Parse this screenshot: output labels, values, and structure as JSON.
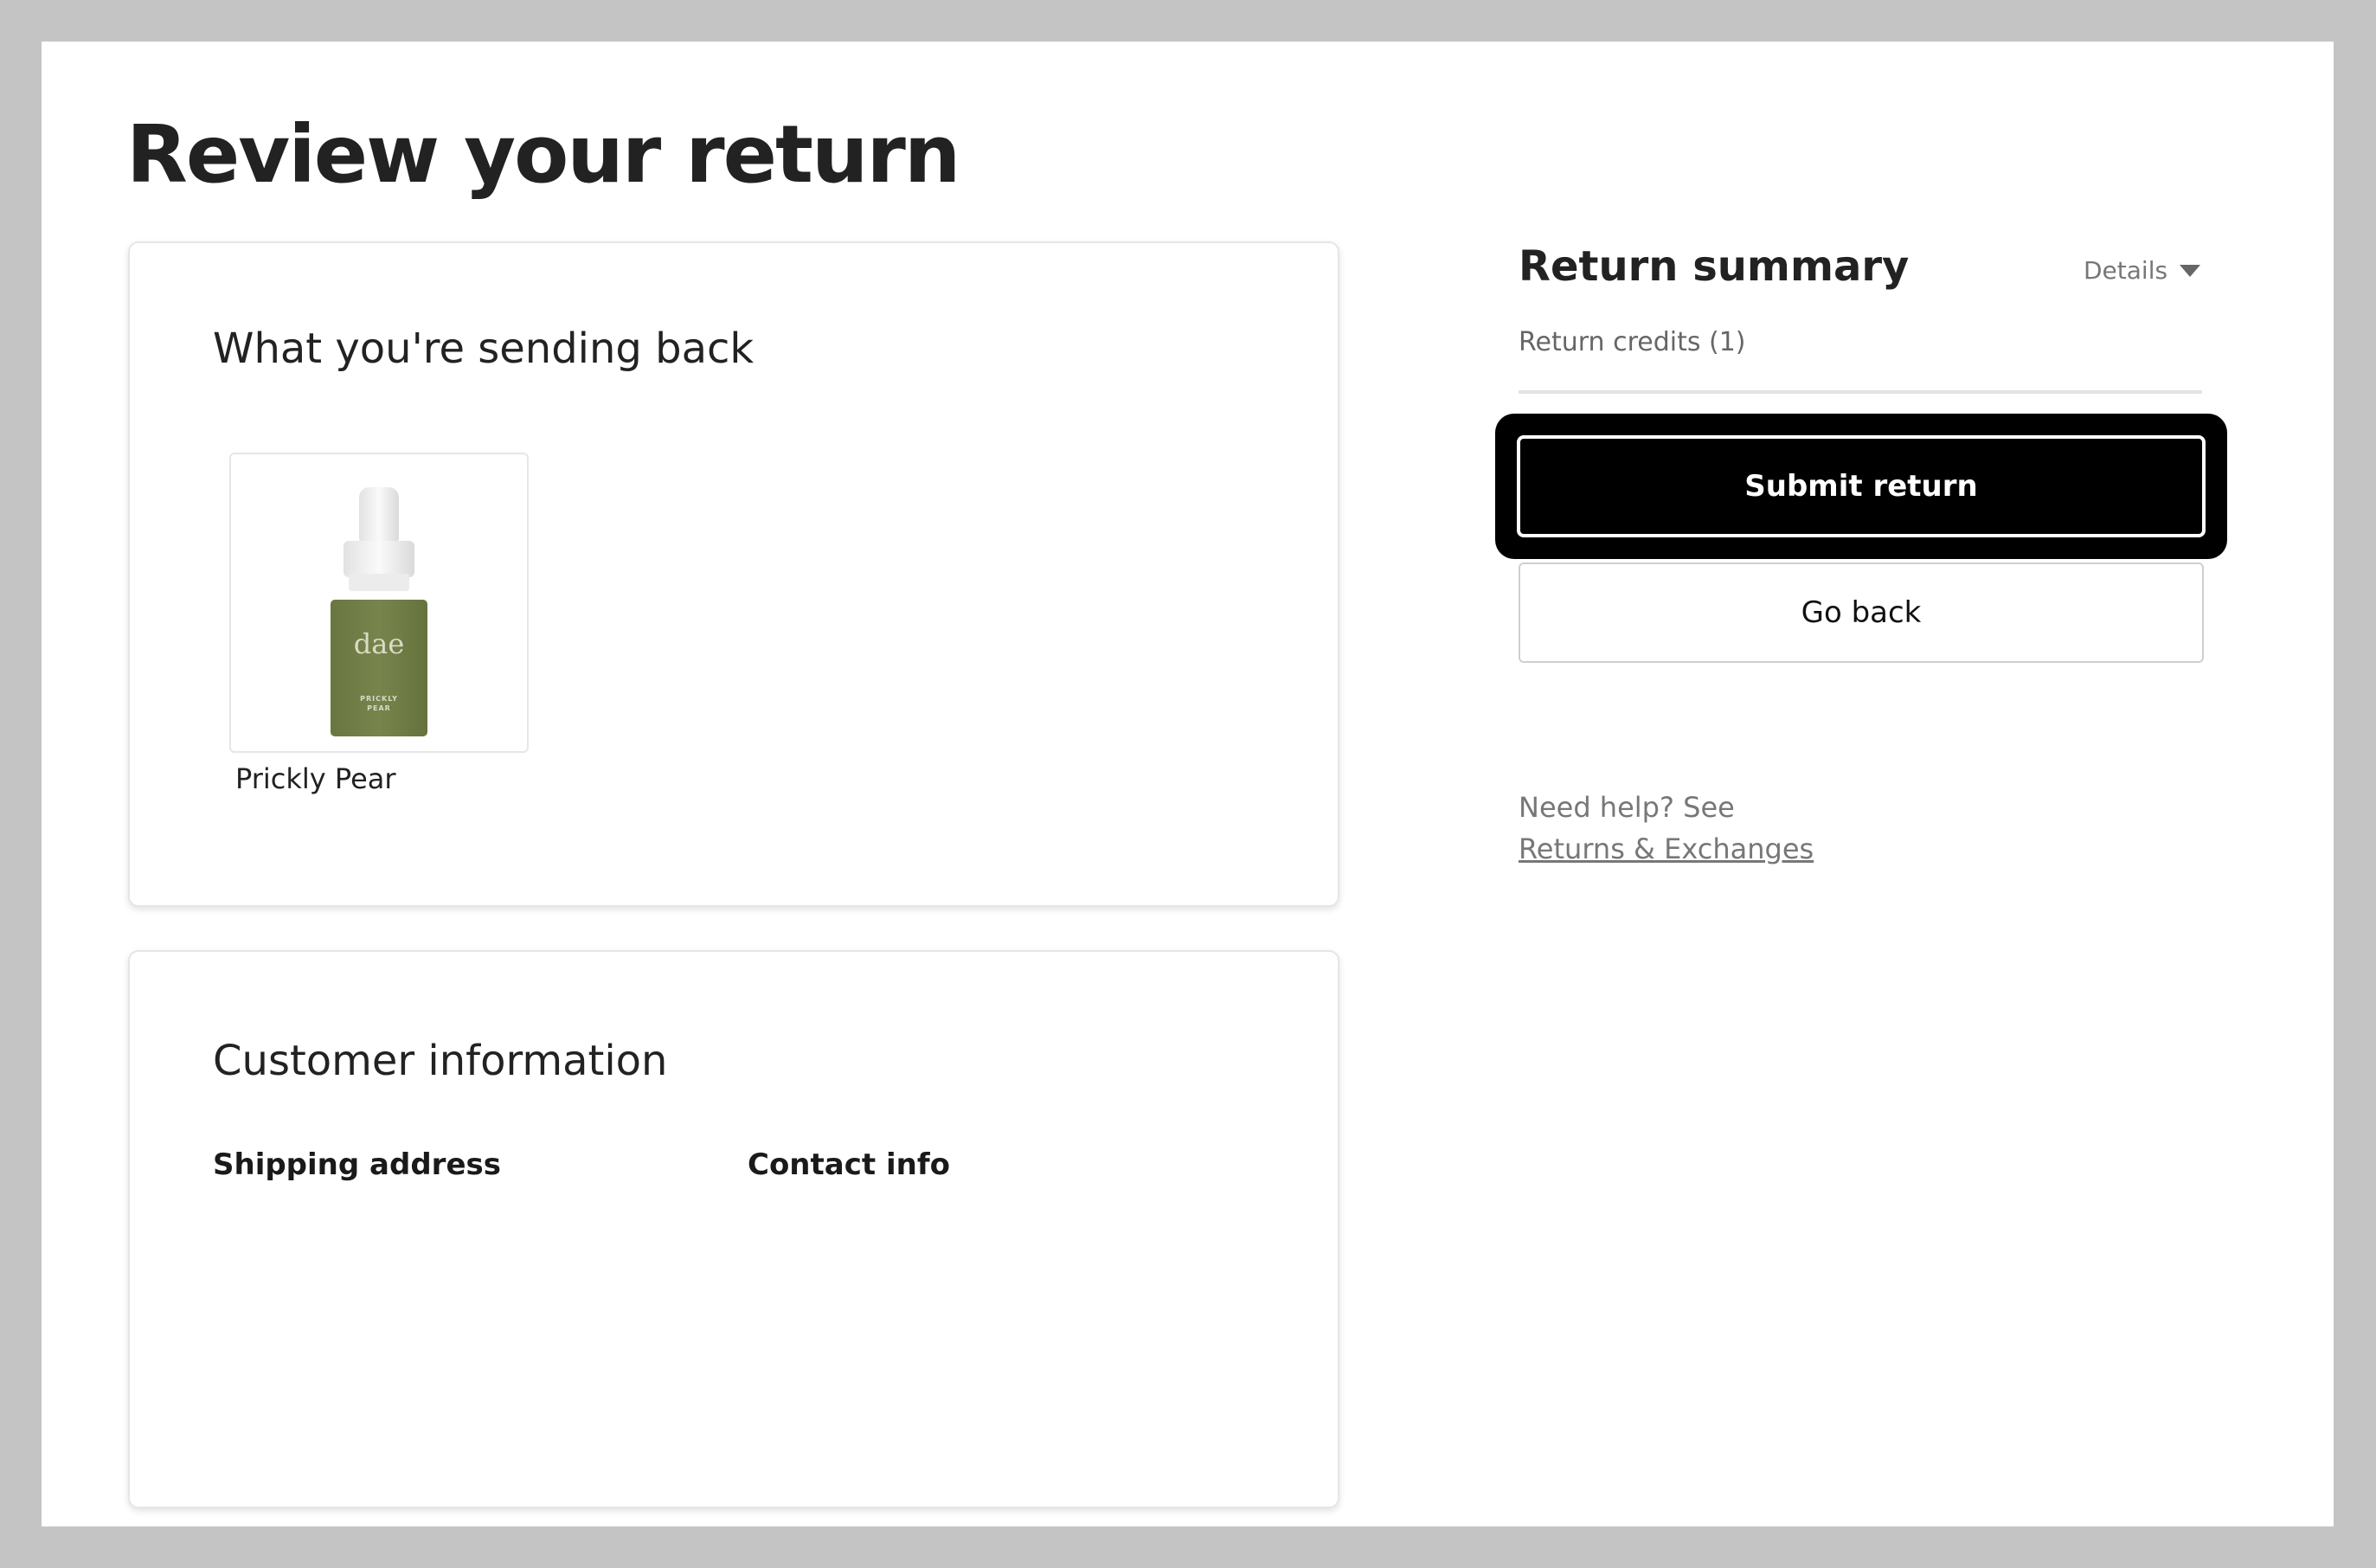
{
  "page": {
    "title": "Review your return"
  },
  "items_card": {
    "title": "What you're sending back",
    "products": [
      {
        "name": "Prickly Pear",
        "image_brand_text": "dae",
        "image_label_text": "PRICKLY PEAR",
        "bottle_color": "#727f47"
      }
    ]
  },
  "customer_card": {
    "title": "Customer information",
    "shipping_heading": "Shipping address",
    "contact_heading": "Contact info"
  },
  "summary": {
    "title": "Return summary",
    "details_label": "Details",
    "credits_label": "Return credits (1)",
    "submit_label": "Submit return",
    "back_label": "Go back",
    "help_text": "Need help? See",
    "help_link": "Returns & Exchanges"
  },
  "colors": {
    "background_frame": "#c4c4c4",
    "primary_button": "#000000",
    "muted_text": "#777777"
  }
}
